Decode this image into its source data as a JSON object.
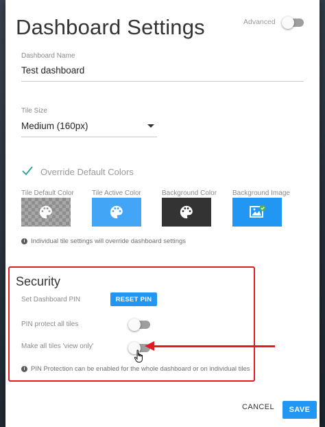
{
  "dialog": {
    "title": "Dashboard Settings",
    "advanced_label": "Advanced"
  },
  "fields": {
    "dashboard_name_label": "Dashboard Name",
    "dashboard_name_value": "Test dashboard",
    "tile_size_label": "Tile Size",
    "tile_size_value": "Medium (160px)"
  },
  "colors_section": {
    "override_label": "Override Default Colors",
    "swatches": [
      {
        "label": "Tile Default Color"
      },
      {
        "label": "Tile Active Color"
      },
      {
        "label": "Background Color"
      },
      {
        "label": "Background Image"
      }
    ],
    "info_text": "Individual tile settings will override dashboard settings"
  },
  "security": {
    "title": "Security",
    "set_pin_label": "Set Dashboard PIN",
    "reset_pin_label": "RESET PIN",
    "protect_all_label": "PIN protect all tiles",
    "view_only_label": "Make all tiles 'view only'",
    "info_text": "PIN Protection can be enabled for the whole dashboard or on individual tiles"
  },
  "actions": {
    "cancel_label": "CANCEL",
    "save_label": "SAVE"
  },
  "theme": {
    "accent": "#2196f3",
    "annotation_red": "#e01b24",
    "active_swatch": "#42a5f5",
    "background_swatch": "#333333"
  },
  "icons": [
    "palette-icon",
    "image-icon",
    "check-icon",
    "info-icon",
    "hand-cursor-icon",
    "dropdown-caret-icon"
  ]
}
